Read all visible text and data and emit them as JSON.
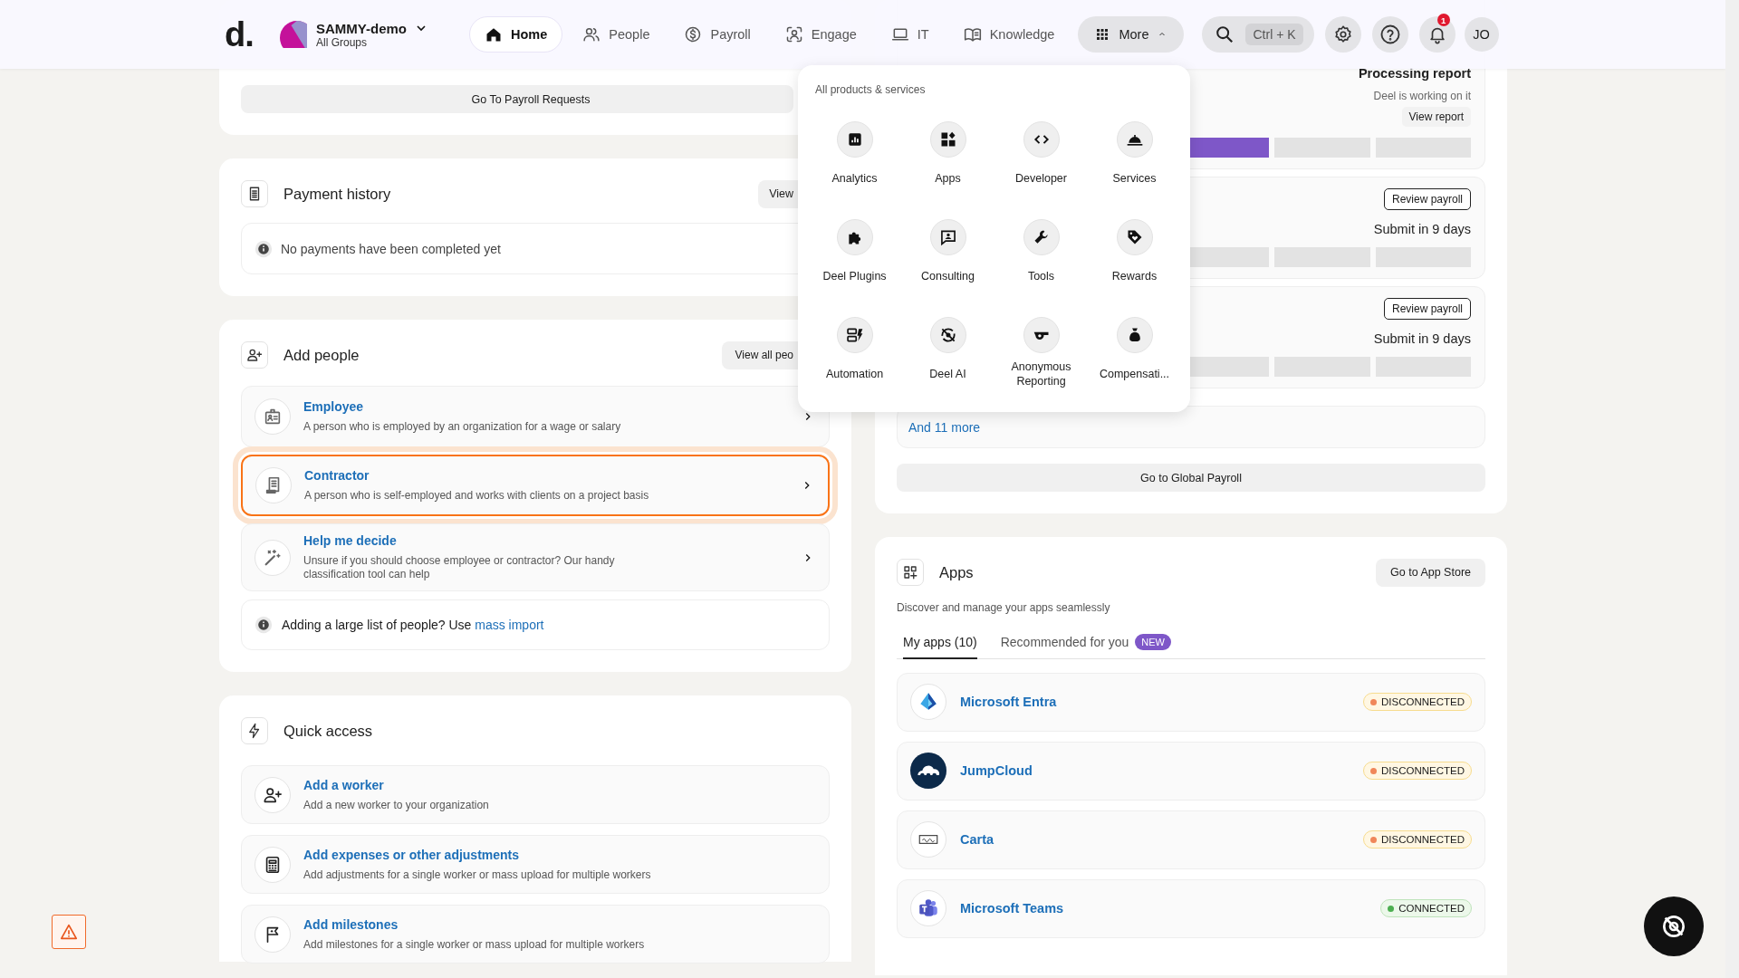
{
  "topbar": {
    "logo": "d.",
    "org": {
      "name": "SAMMY-demo",
      "subtitle": "All Groups"
    },
    "nav": [
      {
        "label": "Home",
        "selected": true
      },
      {
        "label": "People",
        "selected": false
      },
      {
        "label": "Payroll",
        "selected": false
      },
      {
        "label": "Engage",
        "selected": false
      },
      {
        "label": "IT",
        "selected": false
      },
      {
        "label": "Knowledge",
        "selected": false
      }
    ],
    "more": {
      "label": "More",
      "expanded": true
    },
    "search": {
      "shortcut": "Ctrl + K"
    },
    "notifications": {
      "count": "1"
    },
    "user": {
      "initials": "JO"
    }
  },
  "more_menu": {
    "heading": "All products & services",
    "items": [
      {
        "label": "Analytics"
      },
      {
        "label": "Apps"
      },
      {
        "label": "Developer"
      },
      {
        "label": "Services"
      },
      {
        "label": "Deel Plugins"
      },
      {
        "label": "Consulting"
      },
      {
        "label": "Tools"
      },
      {
        "label": "Rewards"
      },
      {
        "label": "Automation"
      },
      {
        "label": "Deel AI"
      },
      {
        "label": "Anonymous Reporting"
      },
      {
        "label": "Compensati..."
      }
    ]
  },
  "payroll_requests": {
    "button": "Go To Payroll Requests"
  },
  "payment_history": {
    "title": "Payment history",
    "button": "View",
    "empty": "No payments have been completed yet"
  },
  "add_people": {
    "title": "Add people",
    "button": "View all peo",
    "options": [
      {
        "title": "Employee",
        "description": "A person who is employed by an organization for a wage or salary",
        "highlighted": false
      },
      {
        "title": "Contractor",
        "description": "A person who is self-employed and works with clients on a project basis",
        "highlighted": true
      },
      {
        "title": "Help me decide",
        "description": "Unsure if you should choose employee or contractor? Our handy classification tool can help",
        "highlighted": false
      }
    ],
    "note": "Adding a large list of people? Use",
    "note_link": "mass import"
  },
  "quick_access": {
    "title": "Quick access",
    "items": [
      {
        "title": "Add a worker",
        "description": "Add a new worker to your organization"
      },
      {
        "title": "Add expenses or other adjustments",
        "description": "Add adjustments for a single worker or mass upload for multiple workers"
      },
      {
        "title": "Add milestones",
        "description": "Add milestones for a single worker or mass upload for multiple workers"
      }
    ]
  },
  "global_payroll": {
    "cycles": [
      {
        "kind": "report",
        "status": "Processing report",
        "detail": "Deel is working on it",
        "action": "View report",
        "level": 0.6
      },
      {
        "kind": "review",
        "action": "Review payroll",
        "status": "Submit in 9 days"
      },
      {
        "kind": "review",
        "action": "Review payroll",
        "status": "Submit in 9 days"
      }
    ],
    "more_link": "And 11 more",
    "button": "Go to Global Payroll"
  },
  "apps": {
    "title": "Apps",
    "button": "Go to App Store",
    "subtitle": "Discover and manage your apps seamlessly",
    "tabs": [
      {
        "label": "My apps (10)",
        "selected": true
      },
      {
        "label": "Recommended for you",
        "badge": "NEW",
        "selected": false
      }
    ],
    "items": [
      {
        "name": "Microsoft Entra",
        "status": "DISCONNECTED",
        "connected": false
      },
      {
        "name": "JumpCloud",
        "status": "DISCONNECTED",
        "connected": false
      },
      {
        "name": "Carta",
        "status": "DISCONNECTED",
        "connected": false
      },
      {
        "name": "Microsoft Teams",
        "status": "CONNECTED",
        "connected": true
      }
    ]
  }
}
